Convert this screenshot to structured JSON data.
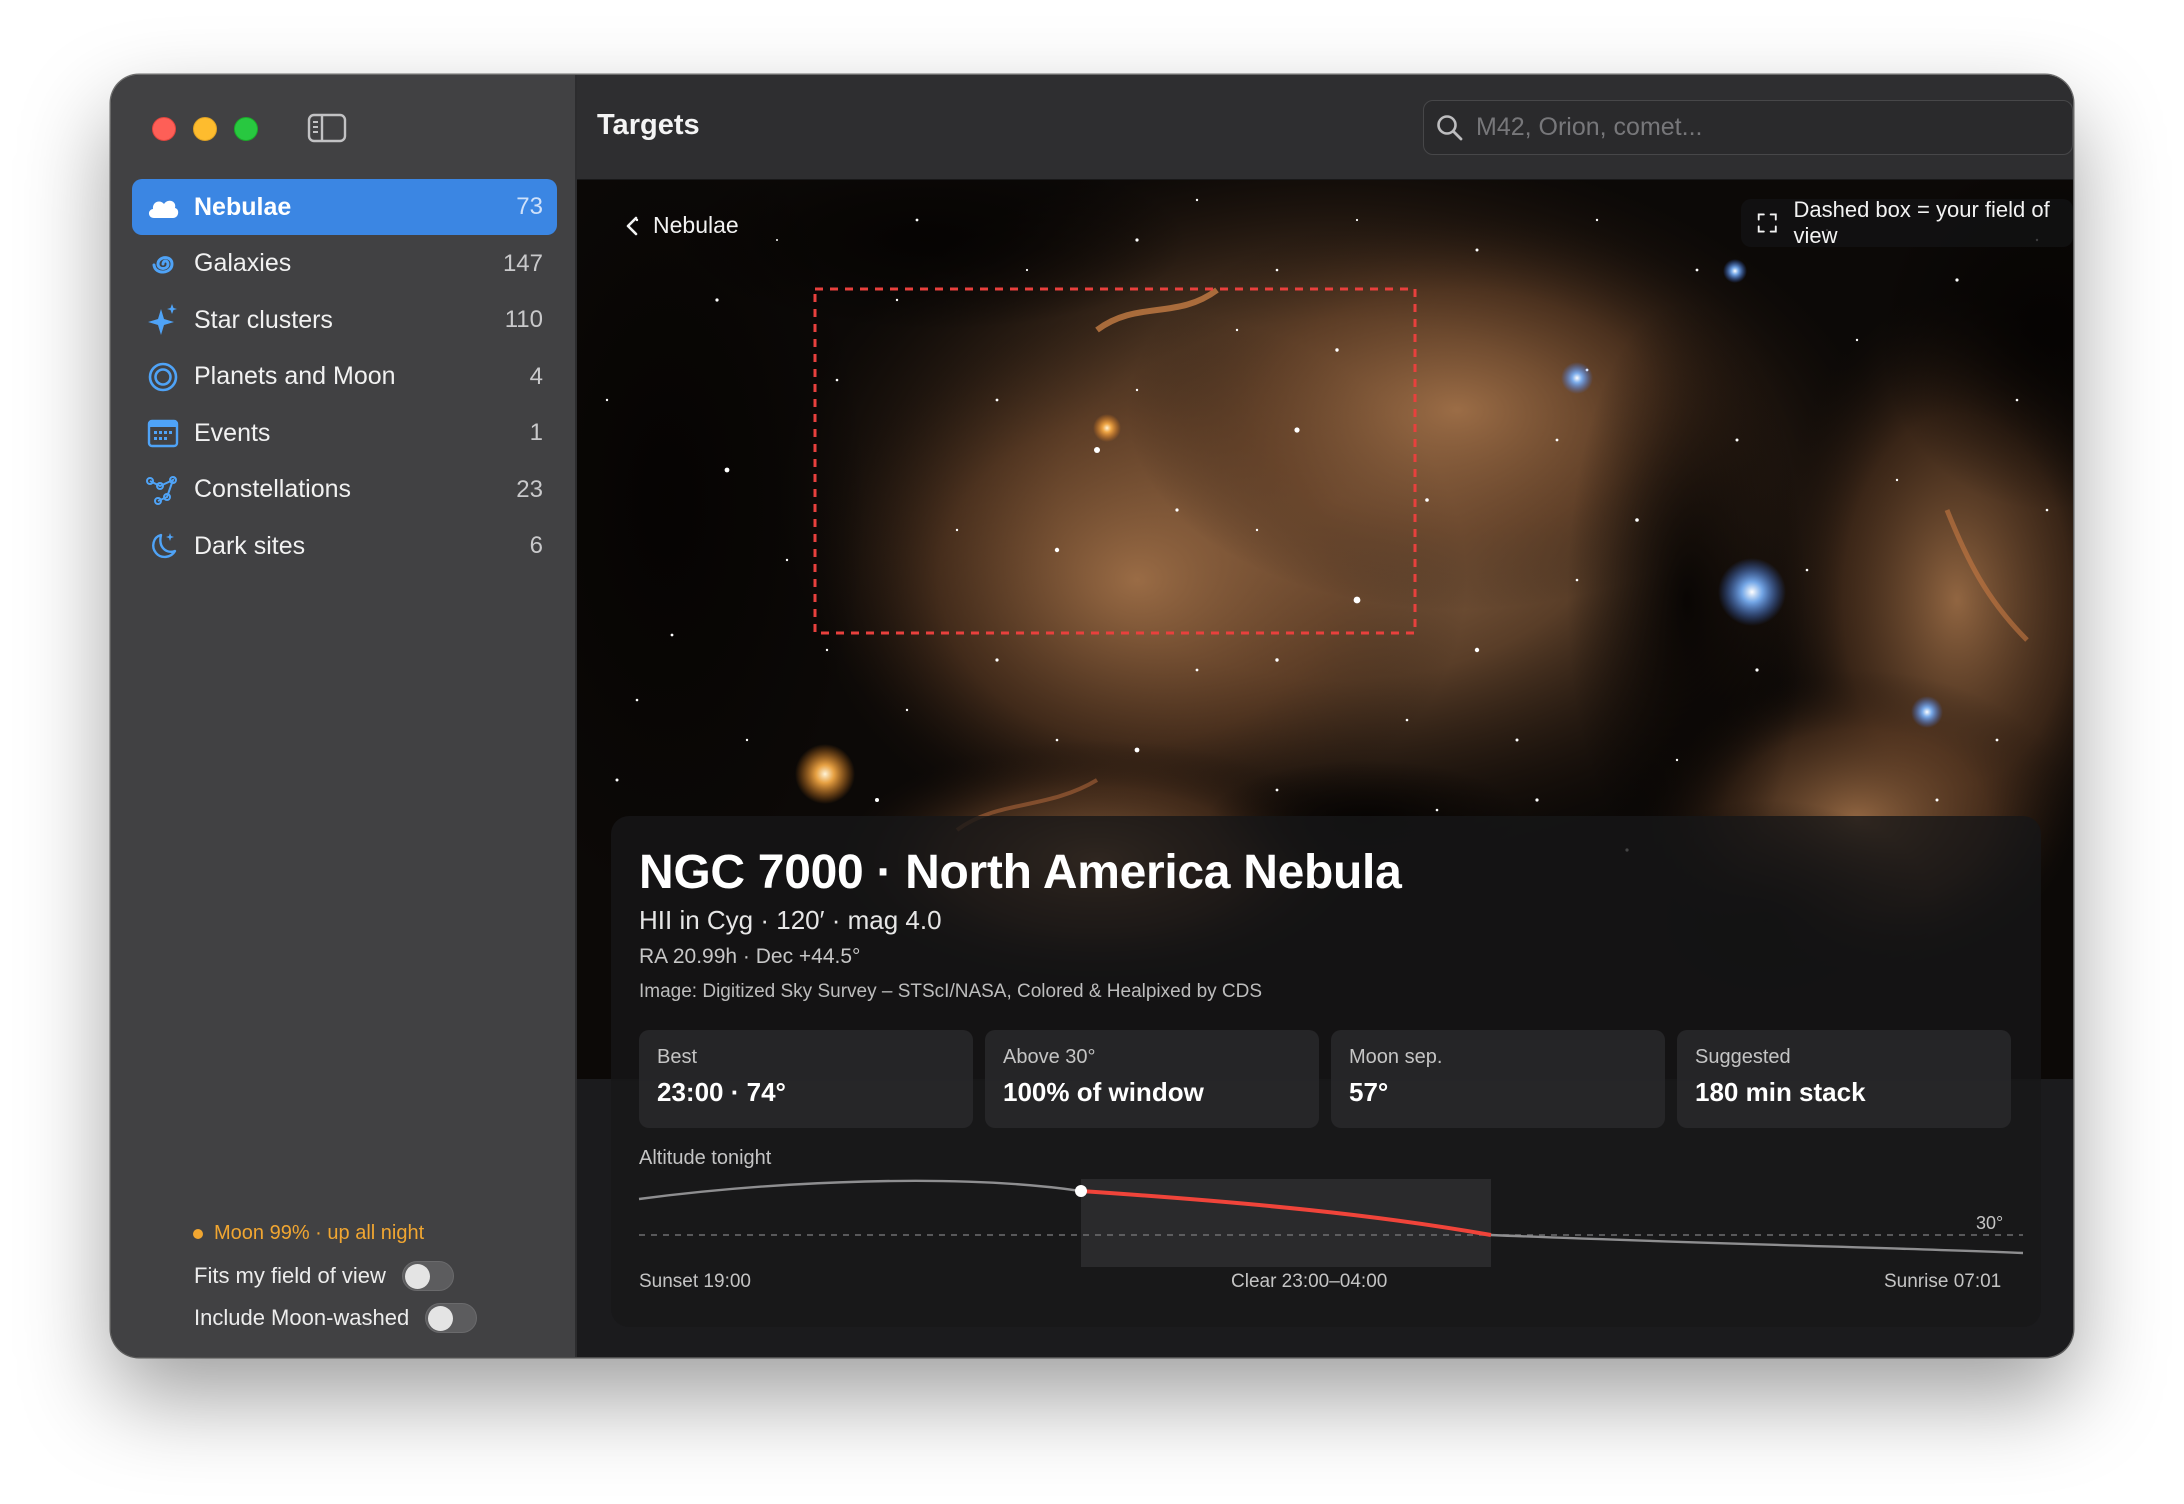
{
  "window": {
    "traffic_lights": [
      "close",
      "minimize",
      "zoom"
    ],
    "sidebar_toggle_icon": "sidebar-icon"
  },
  "sidebar": {
    "items": [
      {
        "label": "Nebulae",
        "count": "73",
        "icon": "cloud-icon",
        "active": true
      },
      {
        "label": "Galaxies",
        "count": "147",
        "icon": "spiral-galaxy-icon"
      },
      {
        "label": "Star clusters",
        "count": "110",
        "icon": "sparkles-icon"
      },
      {
        "label": "Planets and Moon",
        "count": "4",
        "icon": "planet-ring-icon"
      },
      {
        "label": "Events",
        "count": "1",
        "icon": "calendar-icon"
      },
      {
        "label": "Constellations",
        "count": "23",
        "icon": "constellation-icon"
      },
      {
        "label": "Dark sites",
        "count": "6",
        "icon": "moon-stars-icon"
      }
    ],
    "moon_status": "Moon 99% · up all night",
    "filters": [
      {
        "label": "Fits my field of view",
        "on": false
      },
      {
        "label": "Include Moon-washed",
        "on": false
      }
    ]
  },
  "toolbar": {
    "title": "Targets",
    "search_placeholder": "M42, Orion, comet..."
  },
  "hero": {
    "back_label": "Nebulae",
    "fov_legend": "Dashed box = your field of view"
  },
  "target": {
    "title": "NGC 7000 · North America Nebula",
    "subtitle": "HII in Cyg · 120′ · mag 4.0",
    "coords": "RA 20.99h · Dec +44.5°",
    "credit": "Image: Digitized Sky Survey – STScI/NASA, Colored & Healpixed by CDS"
  },
  "stats": [
    {
      "label": "Best",
      "value": "23:00 · 74°"
    },
    {
      "label": "Above 30°",
      "value": "100% of window"
    },
    {
      "label": "Moon sep.",
      "value": "57°"
    },
    {
      "label": "Suggested",
      "value": "180 min stack"
    }
  ],
  "altitude": {
    "label": "Altitude tonight",
    "threshold_label": "30°",
    "sunset": "Sunset 19:00",
    "clear_window": "Clear 23:00–04:00",
    "sunrise": "Sunrise 07:01",
    "colors": {
      "curve": "#8e8e90",
      "highlight": "#f0443a",
      "window_bg": "#2a2a2c"
    }
  },
  "colors": {
    "accent": "#3b86e3",
    "moon": "#f1a631",
    "fov_dash": "#e8403d"
  }
}
